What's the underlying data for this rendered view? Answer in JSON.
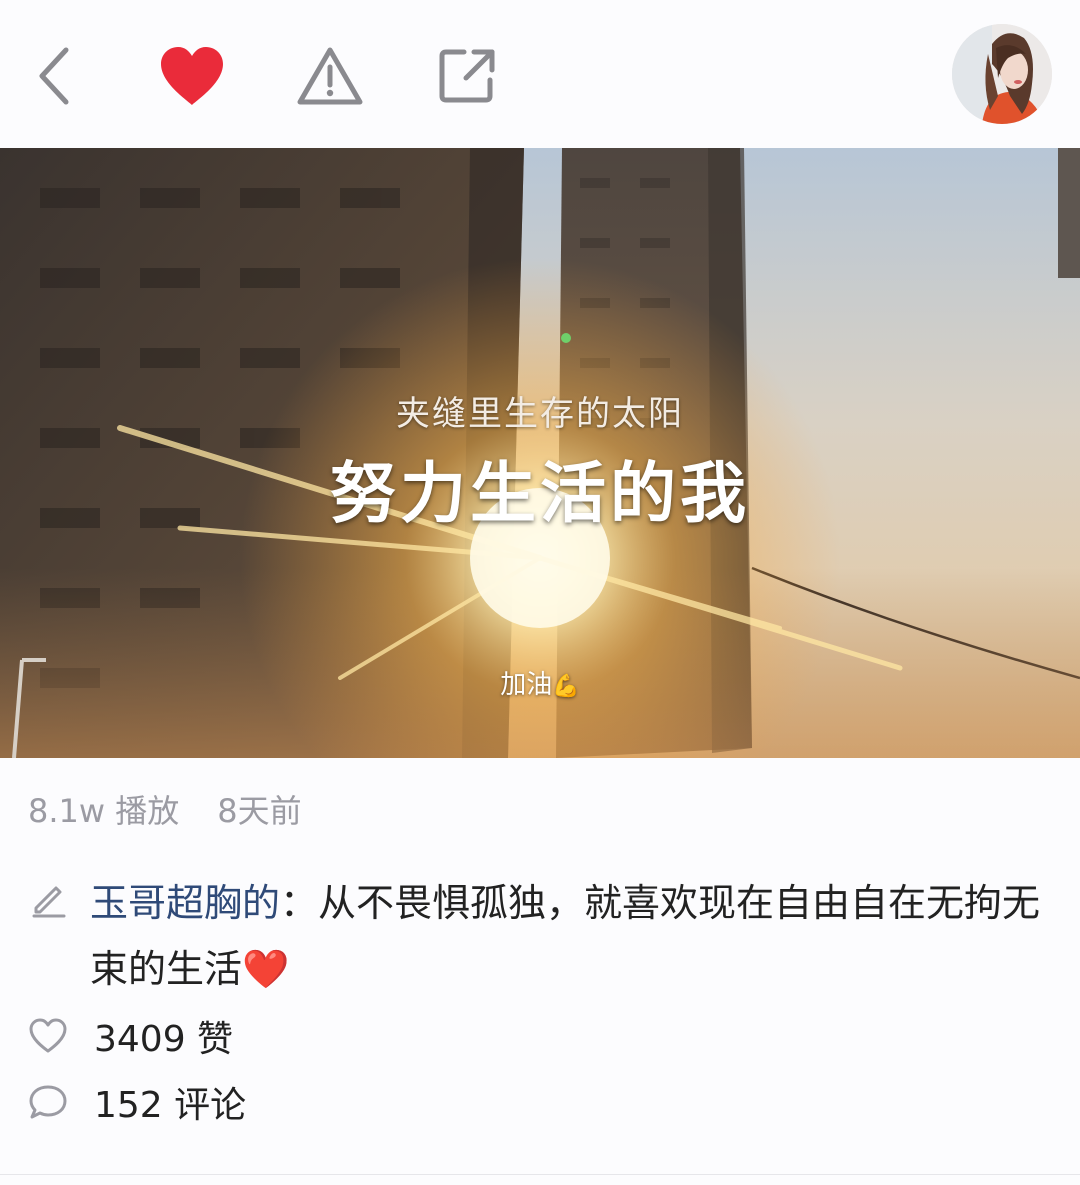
{
  "header": {
    "back_icon": "chevron-left-icon",
    "like_icon": "heart-filled-icon",
    "report_icon": "warning-triangle-icon",
    "share_icon": "share-external-icon",
    "avatar_icon": "user-avatar"
  },
  "video": {
    "subtitle_small": "夹缝里生存的太阳",
    "subtitle_big": "努力生活的我",
    "caption_small": "加油",
    "caption_emoji": "💪"
  },
  "meta": {
    "plays": "8.1w 播放",
    "time": "8天前"
  },
  "post": {
    "author": "玉哥超胸的",
    "separator": "：",
    "text": "从不畏惧孤独，就喜欢现在自由自在无拘无束的生活",
    "emoji": "❤️"
  },
  "stats": {
    "likes": "3409 赞",
    "comments": "152 评论"
  },
  "colors": {
    "heart": "#ea2b3a",
    "author": "#2f4a78",
    "meta_gray": "#9b9ba3",
    "icon_gray": "#8a8a8f"
  }
}
